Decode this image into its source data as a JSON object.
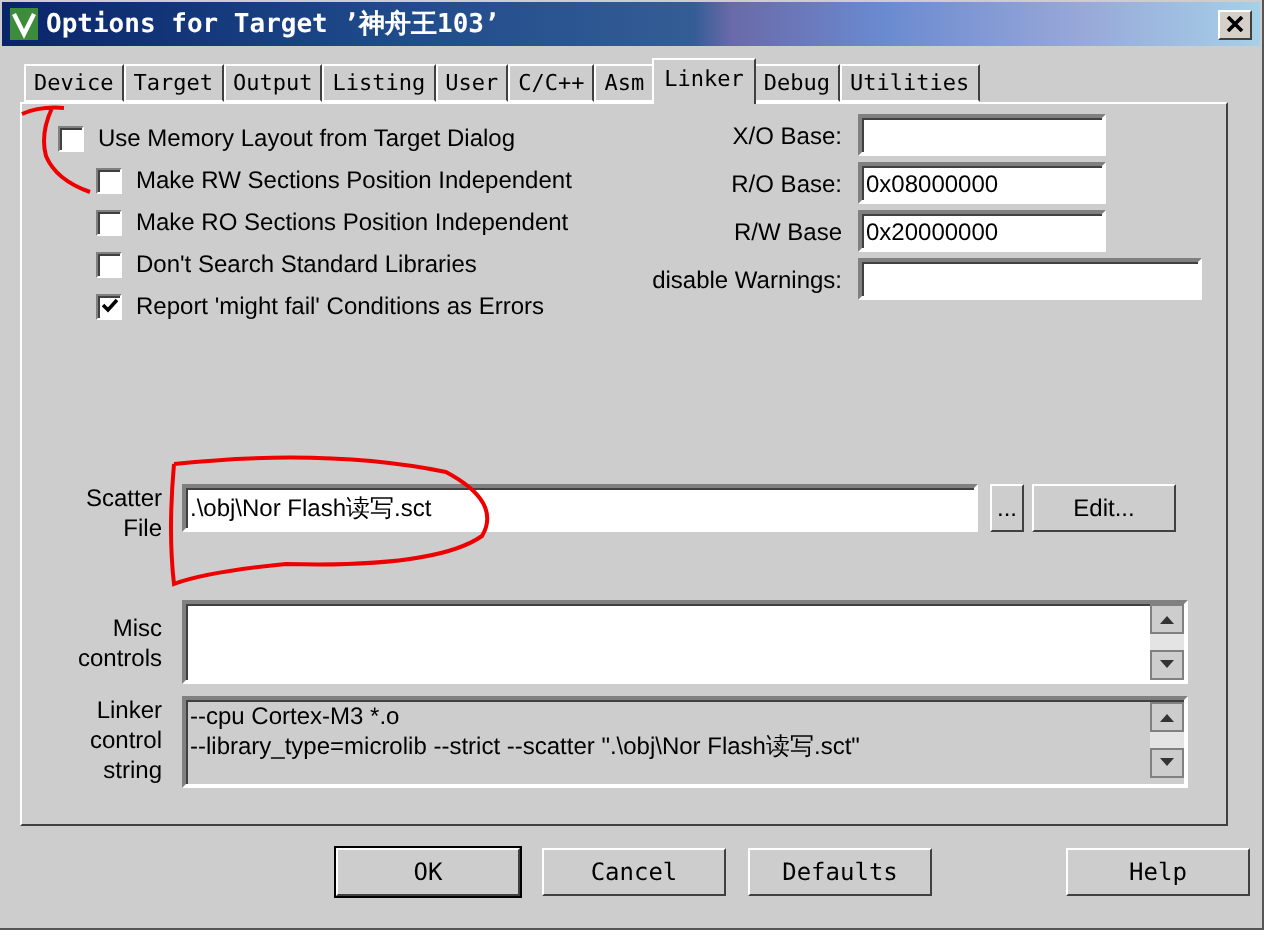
{
  "window": {
    "title": "Options for Target ’神舟王103’"
  },
  "tabs": [
    {
      "label": "Device",
      "selected": false
    },
    {
      "label": "Target",
      "selected": false
    },
    {
      "label": "Output",
      "selected": false
    },
    {
      "label": "Listing",
      "selected": false
    },
    {
      "label": "User",
      "selected": false
    },
    {
      "label": "C/C++",
      "selected": false
    },
    {
      "label": "Asm",
      "selected": false
    },
    {
      "label": "Linker",
      "selected": true
    },
    {
      "label": "Debug",
      "selected": false
    },
    {
      "label": "Utilities",
      "selected": false
    }
  ],
  "options": [
    {
      "label": "Use Memory Layout from Target Dialog",
      "checked": false,
      "children": [
        {
          "label": "Make RW Sections Position Independent",
          "checked": false
        },
        {
          "label": "Make RO Sections Position Independent",
          "checked": false
        },
        {
          "label": "Don't Search Standard Libraries",
          "checked": false
        },
        {
          "label": "Report 'might fail' Conditions as Errors",
          "checked": true
        }
      ]
    }
  ],
  "base_fields": [
    {
      "label": "X/O Base:"
    },
    {
      "label": "R/O Base:",
      "value": "0x08000000"
    },
    {
      "label": "R/W Base",
      "value": "0x20000000"
    },
    {
      "label": "disable Warnings:",
      "kind": "wide"
    }
  ],
  "scatter_file": {
    "label": "Scatter File",
    "value": ".\\obj\\Nor Flash读写.sct",
    "browse_button": "...",
    "edit_button": "Edit..."
  },
  "misc_controls": {
    "label": "Misc controls"
  },
  "linker_control_string": {
    "label": "Linker control string",
    "lines": [
      "--cpu Cortex-M3 *.o",
      "--library_type=microlib --strict --scatter \".\\obj\\Nor Flash读写.sct\""
    ]
  },
  "buttons": [
    {
      "label": "OK",
      "default": true
    },
    {
      "label": "Cancel",
      "default": false
    },
    {
      "label": "Defaults",
      "default": false
    },
    {
      "label": "Help",
      "default": false
    }
  ]
}
